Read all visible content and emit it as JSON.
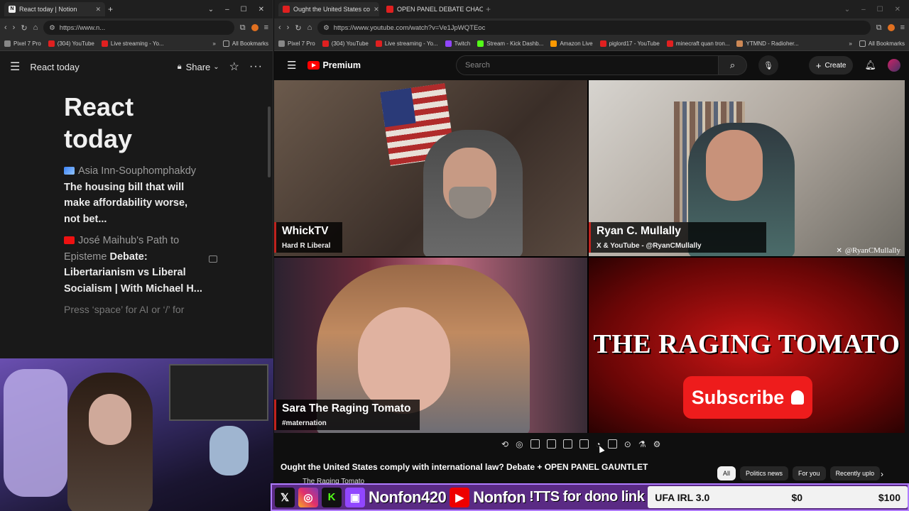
{
  "left_window": {
    "tab": {
      "title": "React today | Notion"
    },
    "address": {
      "url": "https://www.n..."
    },
    "bookmarks": [
      "Pixel 7 Pro",
      "(304) YouTube",
      "Live streaming - Yo..."
    ],
    "all_bookmarks": "All Bookmarks",
    "notion": {
      "breadcrumb": "React today",
      "share_label": "Share",
      "page_title_line1": "React",
      "page_title_line2": "today",
      "items": [
        {
          "source": "Asia Inn-Souphomphakdy",
          "title": "The housing bill that will make affordability worse, not bet..."
        },
        {
          "source": "José Maihub's Path to Episteme",
          "title": "Debate: Libertarianism vs Liberal Socialism | With Michael H..."
        }
      ],
      "placeholder": "Press ‘space’ for AI or ‘/’ for"
    }
  },
  "right_window": {
    "tabs": [
      {
        "title": "Ought the United States co"
      },
      {
        "title": "OPEN PANEL DEBATE CHAOS"
      }
    ],
    "address": {
      "url": "https://www.youtube.com/watch?v=Ve1JpWQTEoc"
    },
    "bookmarks": [
      "Pixel 7 Pro",
      "(304) YouTube",
      "Live streaming - Yo...",
      "Twitch",
      "Stream - Kick Dashb...",
      "Amazon Live",
      "piglord17 - YouTube",
      "minecraft quan tron...",
      "YTMND - Radioher..."
    ],
    "all_bookmarks": "All Bookmarks",
    "youtube": {
      "logo": "Premium",
      "search_placeholder": "Search",
      "create_label": "Create",
      "video_title": "Ought the United States comply with international law? Debate + OPEN PANEL GAUNTLET",
      "channel": "The Raging Tomato",
      "chips": [
        "All",
        "Politics news",
        "For you",
        "Recently uplo"
      ],
      "panels": {
        "p1": {
          "name": "WhickTV",
          "sub": "Hard R Liberal"
        },
        "p2": {
          "name": "Ryan C. Mullally",
          "sub": "X & YouTube - @RyanCMullally",
          "watermark": "@RyanCMullally"
        },
        "p3": {
          "name": "Sara The Raging Tomato",
          "sub": "#maternation"
        },
        "p4": {
          "title": "THE RAGING TOMATO",
          "subscribe": "Subscribe"
        }
      }
    }
  },
  "overlay": {
    "handle": "Nonfon420",
    "yt_handle": "Nonfon",
    "tts": "!TTS for dono link",
    "goal": {
      "title": "UFA IRL 3.0",
      "current": "$0",
      "max": "$100",
      "progress": 0
    },
    "colors": {
      "bar": "#5a2a84",
      "border": "#b07cff"
    }
  }
}
